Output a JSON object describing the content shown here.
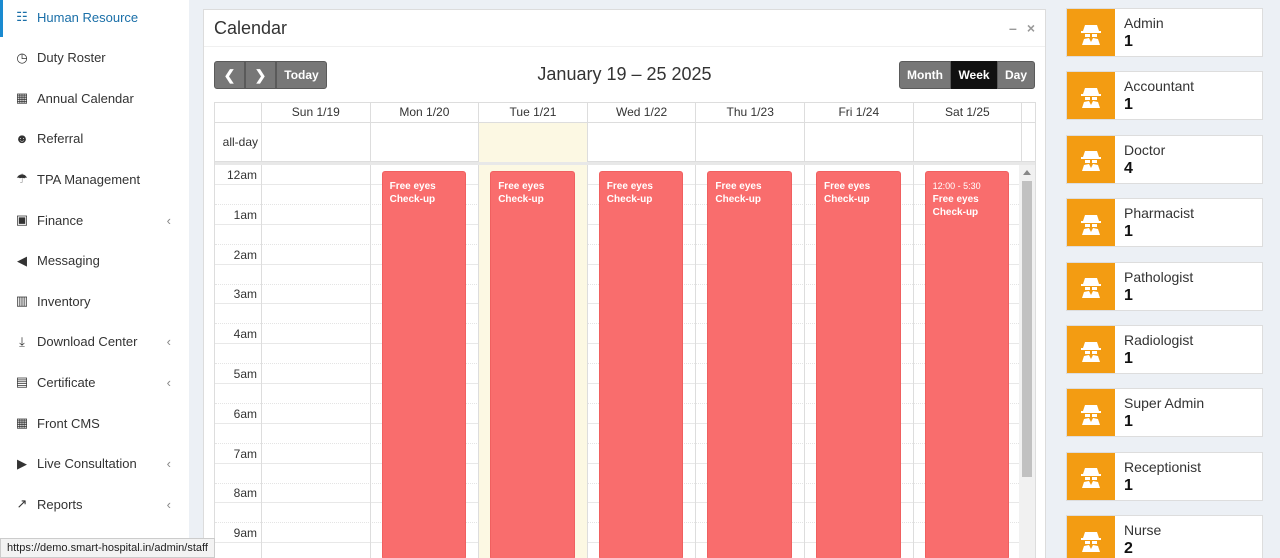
{
  "sidebar": {
    "items": [
      {
        "label": "Human Resource",
        "icon": "sitemap-icon",
        "glyph": "☷",
        "active": true,
        "has_submenu": false
      },
      {
        "label": "Duty Roster",
        "icon": "clock-icon",
        "glyph": "◷",
        "has_submenu": false
      },
      {
        "label": "Annual Calendar",
        "icon": "calculator-icon",
        "glyph": "▦",
        "has_submenu": false
      },
      {
        "label": "Referral",
        "icon": "users-icon",
        "glyph": "☻",
        "has_submenu": false
      },
      {
        "label": "TPA Management",
        "icon": "umbrella-icon",
        "glyph": "☂",
        "has_submenu": false
      },
      {
        "label": "Finance",
        "icon": "money-icon",
        "glyph": "▣",
        "has_submenu": true
      },
      {
        "label": "Messaging",
        "icon": "bullhorn-icon",
        "glyph": "◀",
        "has_submenu": false
      },
      {
        "label": "Inventory",
        "icon": "cubes-icon",
        "glyph": "▥",
        "has_submenu": false
      },
      {
        "label": "Download Center",
        "icon": "download-icon",
        "glyph": "⤓",
        "has_submenu": true
      },
      {
        "label": "Certificate",
        "icon": "newspaper-icon",
        "glyph": "▤",
        "has_submenu": true
      },
      {
        "label": "Front CMS",
        "icon": "table-icon",
        "glyph": "▦",
        "has_submenu": false
      },
      {
        "label": "Live Consultation",
        "icon": "video-icon",
        "glyph": "▶",
        "has_submenu": true
      },
      {
        "label": "Reports",
        "icon": "line-chart-icon",
        "glyph": "↗",
        "has_submenu": true
      }
    ],
    "submenu_glyph": "‹"
  },
  "calendar": {
    "panel_title": "Calendar",
    "minimize_glyph": "–",
    "close_glyph": "×",
    "prev_glyph": "❮",
    "next_glyph": "❯",
    "today_label": "Today",
    "range_title": "January 19 – 25 2025",
    "views": [
      "Month",
      "Week",
      "Day"
    ],
    "active_view": "Week",
    "allday_label": "all-day",
    "days": [
      "Sun 1/19",
      "Mon 1/20",
      "Tue 1/21",
      "Wed 1/22",
      "Thu 1/23",
      "Fri 1/24",
      "Sat 1/25"
    ],
    "today_index": 2,
    "times": [
      "12am",
      "1am",
      "2am",
      "3am",
      "4am",
      "5am",
      "6am",
      "7am",
      "8am",
      "9am"
    ],
    "events": [
      {
        "day": 1,
        "time": "",
        "title_line1": "Free eyes",
        "title_line2": "Check-up"
      },
      {
        "day": 2,
        "time": "",
        "title_line1": "Free eyes",
        "title_line2": "Check-up"
      },
      {
        "day": 3,
        "time": "",
        "title_line1": "Free eyes",
        "title_line2": "Check-up"
      },
      {
        "day": 4,
        "time": "",
        "title_line1": "Free eyes",
        "title_line2": "Check-up"
      },
      {
        "day": 5,
        "time": "",
        "title_line1": "Free eyes",
        "title_line2": "Check-up"
      },
      {
        "day": 6,
        "time": "12:00 - 5:30",
        "title_line1": "Free eyes",
        "title_line2": "Check-up"
      }
    ]
  },
  "staff": [
    {
      "role": "Admin",
      "count": "1"
    },
    {
      "role": "Accountant",
      "count": "1"
    },
    {
      "role": "Doctor",
      "count": "4"
    },
    {
      "role": "Pharmacist",
      "count": "1"
    },
    {
      "role": "Pathologist",
      "count": "1"
    },
    {
      "role": "Radiologist",
      "count": "1"
    },
    {
      "role": "Super Admin",
      "count": "1"
    },
    {
      "role": "Receptionist",
      "count": "1"
    },
    {
      "role": "Nurse",
      "count": "2"
    }
  ],
  "status_bar": {
    "url": "https://demo.smart-hospital.in/admin/staff"
  },
  "colors": {
    "accent": "#1a8ad0",
    "event": "#f96d6d",
    "staff_icon_bg": "#f39c12",
    "today_bg": "#fcf8e3"
  }
}
